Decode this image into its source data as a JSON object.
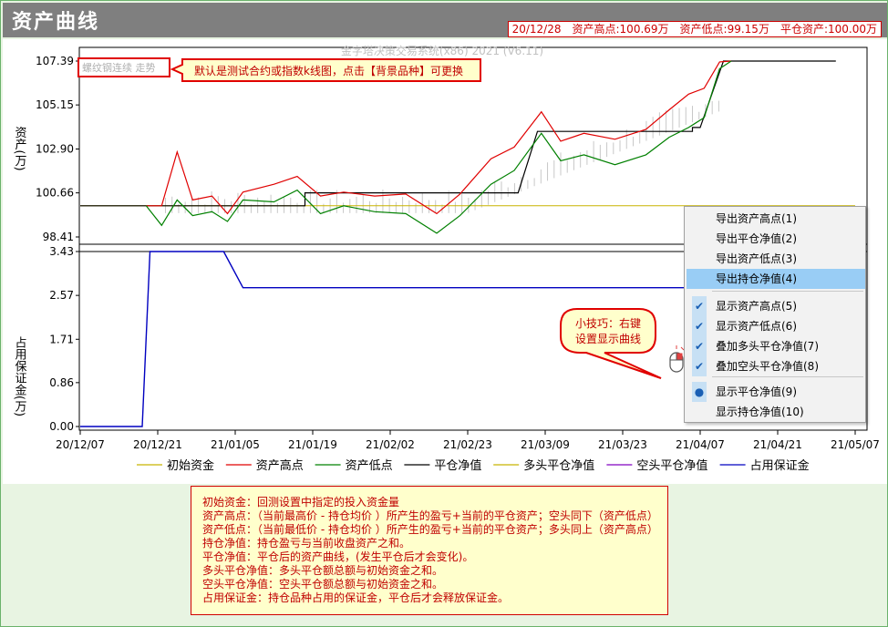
{
  "window": {
    "title": "资产曲线",
    "summary": {
      "date": "20/12/28",
      "high": "资产高点:100.69万",
      "low": "资产低点:99.15万",
      "close": "平仓资产:100.00万"
    }
  },
  "chart": {
    "watermark": "金字塔决策交易系统(x86) 2021 (V6.11)",
    "top_panel": {
      "ylabel": "资产(万)",
      "y_ticks": [
        "107.39",
        "105.15",
        "102.90",
        "100.66",
        "98.41"
      ]
    },
    "bottom_panel": {
      "ylabel": "占用保证金(万)",
      "y_ticks": [
        "3.43",
        "2.57",
        "1.71",
        "0.86",
        "0.00"
      ]
    },
    "x_ticks": [
      "20/12/07",
      "20/12/21",
      "21/01/05",
      "21/01/19",
      "21/02/02",
      "21/02/23",
      "21/03/09",
      "21/03/23",
      "21/04/07",
      "21/04/21",
      "21/05/07"
    ],
    "badge": "螺纹钢连续 走势",
    "tip_box": "默认是测试合约或指数k线图，点击【背景品种】可更换",
    "bubble_line1": "小技巧：右键",
    "bubble_line2": "设置显示曲线",
    "legend": [
      {
        "label": "初始资金",
        "color": "#c8b400"
      },
      {
        "label": "资产高点",
        "color": "#e00000"
      },
      {
        "label": "资产低点",
        "color": "#008000"
      },
      {
        "label": "平仓净值",
        "color": "#000000"
      },
      {
        "label": "多头平仓净值",
        "color": "#c8b400"
      },
      {
        "label": "空头平仓净值",
        "color": "#8000c0"
      },
      {
        "label": "占用保证金",
        "color": "#0000c0"
      }
    ]
  },
  "context_menu": {
    "items": [
      {
        "label": "导出资产高点(1)",
        "mark": ""
      },
      {
        "label": "导出平仓净值(2)",
        "mark": ""
      },
      {
        "label": "导出资产低点(3)",
        "mark": ""
      },
      {
        "label": "导出持仓净值(4)",
        "mark": "",
        "highlighted": true
      },
      {
        "label": "显示资产高点(5)",
        "mark": "✔"
      },
      {
        "label": "显示资产低点(6)",
        "mark": "✔"
      },
      {
        "label": "叠加多头平仓净值(7)",
        "mark": "✔"
      },
      {
        "label": "叠加空头平仓净值(8)",
        "mark": "✔"
      },
      {
        "label": "显示平仓净值(9)",
        "mark": "●"
      },
      {
        "label": "显示持仓净值(10)",
        "mark": ""
      }
    ]
  },
  "notes": [
    "初始资金：回测设置中指定的投入资金量",
    "资产高点：（当前最高价 - 持仓均价 ）所产生的盈亏+当前的平仓资产；空头同下（资产低点）",
    "资产低点：（当前最低价 - 持仓均价 ）所产生的盈亏+当前的平仓资产；多头同上（资产高点）",
    "持仓净值：持仓盈亏与当前收盘资产之和。",
    "平仓净值：平仓后的资产曲线，(发生平仓后才会变化)。",
    "多头平仓净值：多头平仓额总额与初始资金之和。",
    "空头平仓净值：空头平仓额总额与初始资金之和。",
    "占用保证金：持仓品种占用的保证金，平仓后才会释放保证金。"
  ],
  "chart_data": {
    "type": "line",
    "x_categories": [
      "20/12/07",
      "20/12/21",
      "21/01/05",
      "21/01/19",
      "21/02/02",
      "21/02/23",
      "21/03/09",
      "21/03/23",
      "21/04/07",
      "21/04/21",
      "21/05/07"
    ],
    "top": {
      "ylabel": "资产(万)",
      "ylim": [
        98.41,
        107.39
      ],
      "series": [
        {
          "name": "初始资金",
          "color": "#c8b400",
          "points": [
            [
              0,
              100.0
            ],
            [
              10,
              100.0
            ]
          ]
        },
        {
          "name": "平仓净值",
          "color": "#000000",
          "points": [
            [
              0,
              100.0
            ],
            [
              1.05,
              100.0
            ],
            [
              2.9,
              100.0
            ],
            [
              2.9,
              100.66
            ],
            [
              5.65,
              100.66
            ],
            [
              5.9,
              103.8
            ],
            [
              7.9,
              103.8
            ],
            [
              7.9,
              104.0
            ],
            [
              8.0,
              104.0
            ],
            [
              8.3,
              107.39
            ],
            [
              9.75,
              107.39
            ]
          ]
        },
        {
          "name": "资产高点",
          "color": "#e00000",
          "points": [
            [
              0.85,
              100.0
            ],
            [
              1.05,
              100.0
            ],
            [
              1.25,
              102.75
            ],
            [
              1.45,
              100.3
            ],
            [
              1.7,
              100.5
            ],
            [
              1.9,
              99.6
            ],
            [
              2.1,
              100.7
            ],
            [
              2.5,
              101.1
            ],
            [
              2.8,
              101.5
            ],
            [
              3.1,
              100.5
            ],
            [
              3.4,
              100.7
            ],
            [
              3.8,
              100.5
            ],
            [
              4.2,
              100.6
            ],
            [
              4.6,
              99.6
            ],
            [
              4.9,
              100.6
            ],
            [
              5.3,
              102.4
            ],
            [
              5.6,
              103.0
            ],
            [
              5.95,
              104.8
            ],
            [
              6.2,
              103.3
            ],
            [
              6.5,
              103.7
            ],
            [
              6.9,
              103.4
            ],
            [
              7.3,
              103.9
            ],
            [
              7.6,
              104.9
            ],
            [
              7.85,
              105.7
            ],
            [
              8.05,
              106.0
            ],
            [
              8.25,
              107.35
            ],
            [
              8.4,
              107.39
            ]
          ]
        },
        {
          "name": "资产低点",
          "color": "#008000",
          "points": [
            [
              0.85,
              100.0
            ],
            [
              1.05,
              99.0
            ],
            [
              1.25,
              100.3
            ],
            [
              1.45,
              99.5
            ],
            [
              1.7,
              99.7
            ],
            [
              1.9,
              99.2
            ],
            [
              2.1,
              100.3
            ],
            [
              2.5,
              100.2
            ],
            [
              2.8,
              100.8
            ],
            [
              3.1,
              99.6
            ],
            [
              3.4,
              100.0
            ],
            [
              3.8,
              99.7
            ],
            [
              4.2,
              99.6
            ],
            [
              4.6,
              98.6
            ],
            [
              4.9,
              99.5
            ],
            [
              5.3,
              101.1
            ],
            [
              5.6,
              101.8
            ],
            [
              5.95,
              103.7
            ],
            [
              6.2,
              102.3
            ],
            [
              6.5,
              102.6
            ],
            [
              6.9,
              102.1
            ],
            [
              7.3,
              102.6
            ],
            [
              7.6,
              103.5
            ],
            [
              7.85,
              104.0
            ],
            [
              8.05,
              104.5
            ],
            [
              8.25,
              107.0
            ],
            [
              8.4,
              107.39
            ]
          ]
        }
      ]
    },
    "bottom": {
      "ylabel": "占用保证金(万)",
      "ylim": [
        0.0,
        3.43
      ],
      "series": [
        {
          "name": "占用保证金",
          "color": "#0000c0",
          "points": [
            [
              0,
              0.0
            ],
            [
              0.8,
              0.0
            ],
            [
              0.9,
              3.43
            ],
            [
              1.85,
              3.43
            ],
            [
              2.1,
              2.72
            ],
            [
              9.75,
              2.72
            ]
          ]
        }
      ]
    },
    "legend_position": "bottom"
  }
}
